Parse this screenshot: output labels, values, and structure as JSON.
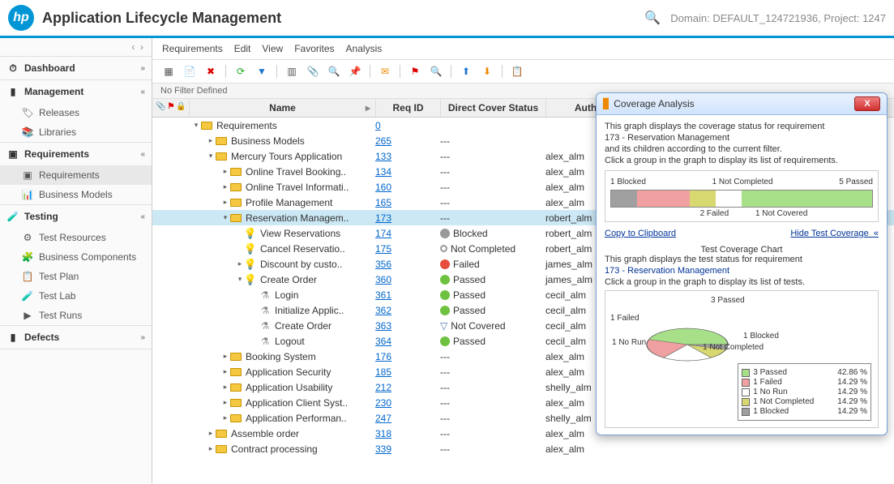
{
  "header": {
    "app_title": "Application Lifecycle Management",
    "domain_label": "Domain: DEFAULT_124721936, Project: 1247"
  },
  "sidebar": {
    "sections": [
      {
        "label": "Dashboard",
        "expand": "»",
        "items": []
      },
      {
        "label": "Management",
        "expand": "«",
        "items": [
          {
            "label": "Releases"
          },
          {
            "label": "Libraries"
          }
        ]
      },
      {
        "label": "Requirements",
        "expand": "«",
        "items": [
          {
            "label": "Requirements",
            "selected": true
          },
          {
            "label": "Business Models"
          }
        ]
      },
      {
        "label": "Testing",
        "expand": "«",
        "items": [
          {
            "label": "Test Resources"
          },
          {
            "label": "Business Components"
          },
          {
            "label": "Test Plan"
          },
          {
            "label": "Test Lab"
          },
          {
            "label": "Test Runs"
          }
        ]
      },
      {
        "label": "Defects",
        "expand": "»",
        "items": []
      }
    ]
  },
  "menubar": [
    "Requirements",
    "Edit",
    "View",
    "Favorites",
    "Analysis"
  ],
  "filter_text": "No Filter Defined",
  "columns": {
    "name": "Name",
    "reqid": "Req ID",
    "status": "Direct Cover Status",
    "author": "Author"
  },
  "rows": [
    {
      "indent": 0,
      "tog": "▾",
      "icon": "folder",
      "name": "Requirements",
      "reqid": "0",
      "status": "",
      "sicon": "",
      "author": ""
    },
    {
      "indent": 1,
      "tog": "▸",
      "icon": "folder",
      "name": "Business Models",
      "reqid": "265",
      "status": "---",
      "sicon": "",
      "author": ""
    },
    {
      "indent": 1,
      "tog": "▾",
      "icon": "folder",
      "name": "Mercury Tours Application",
      "reqid": "133",
      "status": "---",
      "sicon": "",
      "author": "alex_alm"
    },
    {
      "indent": 2,
      "tog": "▸",
      "icon": "folder",
      "name": "Online Travel Booking..",
      "reqid": "134",
      "status": "---",
      "sicon": "",
      "author": "alex_alm"
    },
    {
      "indent": 2,
      "tog": "▸",
      "icon": "folder",
      "name": "Online Travel Informati..",
      "reqid": "160",
      "status": "---",
      "sicon": "",
      "author": "alex_alm"
    },
    {
      "indent": 2,
      "tog": "▸",
      "icon": "folder",
      "name": "Profile Management",
      "reqid": "165",
      "status": "---",
      "sicon": "",
      "author": "alex_alm"
    },
    {
      "indent": 2,
      "tog": "▾",
      "icon": "folder",
      "name": "Reservation Managem..",
      "reqid": "173",
      "status": "---",
      "sicon": "",
      "author": "robert_alm",
      "sel": true
    },
    {
      "indent": 3,
      "tog": "",
      "icon": "bulb",
      "name": "View Reservations",
      "reqid": "174",
      "status": "Blocked",
      "sicon": "blocked",
      "author": "robert_alm"
    },
    {
      "indent": 3,
      "tog": "",
      "icon": "bulb",
      "name": "Cancel Reservatio..",
      "reqid": "175",
      "status": "Not Completed",
      "sicon": "notcomp",
      "author": "robert_alm"
    },
    {
      "indent": 3,
      "tog": "▸",
      "icon": "bulb",
      "name": "Discount by custo..",
      "reqid": "356",
      "status": "Failed",
      "sicon": "failed",
      "author": "james_alm"
    },
    {
      "indent": 3,
      "tog": "▾",
      "icon": "bulb",
      "name": "Create Order",
      "reqid": "360",
      "status": "Passed",
      "sicon": "passed",
      "author": "james_alm"
    },
    {
      "indent": 4,
      "tog": "",
      "icon": "flask",
      "name": "Login",
      "reqid": "361",
      "status": "Passed",
      "sicon": "passed",
      "author": "cecil_alm"
    },
    {
      "indent": 4,
      "tog": "",
      "icon": "flask",
      "name": "Initialize Applic..",
      "reqid": "362",
      "status": "Passed",
      "sicon": "passed",
      "author": "cecil_alm"
    },
    {
      "indent": 4,
      "tog": "",
      "icon": "flask",
      "name": "Create Order",
      "reqid": "363",
      "status": "Not Covered",
      "sicon": "notcov",
      "author": "cecil_alm"
    },
    {
      "indent": 4,
      "tog": "",
      "icon": "flask",
      "name": "Logout",
      "reqid": "364",
      "status": "Passed",
      "sicon": "passed",
      "author": "cecil_alm"
    },
    {
      "indent": 2,
      "tog": "▸",
      "icon": "folder",
      "name": "Booking System",
      "reqid": "176",
      "status": "---",
      "sicon": "",
      "author": "alex_alm"
    },
    {
      "indent": 2,
      "tog": "▸",
      "icon": "folder",
      "name": "Application Security",
      "reqid": "185",
      "status": "---",
      "sicon": "",
      "author": "alex_alm"
    },
    {
      "indent": 2,
      "tog": "▸",
      "icon": "folder",
      "name": "Application Usability",
      "reqid": "212",
      "status": "---",
      "sicon": "",
      "author": "shelly_alm"
    },
    {
      "indent": 2,
      "tog": "▸",
      "icon": "folder",
      "name": "Application Client Syst..",
      "reqid": "230",
      "status": "---",
      "sicon": "",
      "author": "alex_alm"
    },
    {
      "indent": 2,
      "tog": "▸",
      "icon": "folder",
      "name": "Application Performan..",
      "reqid": "247",
      "status": "---",
      "sicon": "",
      "author": "shelly_alm"
    },
    {
      "indent": 1,
      "tog": "▸",
      "icon": "folder",
      "name": "Assemble order",
      "reqid": "318",
      "status": "---",
      "sicon": "",
      "author": "alex_alm"
    },
    {
      "indent": 1,
      "tog": "▸",
      "icon": "folder",
      "name": "Contract processing",
      "reqid": "339",
      "status": "---",
      "sicon": "",
      "author": "alex_alm"
    }
  ],
  "panel": {
    "title": "Coverage Analysis",
    "intro1": "This graph displays the coverage status for requirement",
    "intro2": "173 - Reservation Management",
    "intro3": "and its children according to the current filter.",
    "intro4": "Click a group in the graph to display its list of requirements.",
    "bar_top": {
      "l1": "1 Blocked",
      "l2": "1 Not Completed",
      "l3": "5 Passed"
    },
    "bar_bot": {
      "l1": "2 Failed",
      "l2": "1 Not Covered"
    },
    "copy": "Copy to Clipboard",
    "hide": "Hide Test Coverage",
    "chart2_title": "Test Coverage Chart",
    "chart2_p1": "This graph displays the test status for requirement",
    "chart2_p2": "173 - Reservation Management",
    "chart2_p3": "Click a group in the graph to display its list of tests.",
    "pie_labels": {
      "p": "3 Passed",
      "f": "1 Failed",
      "n": "1 No Run",
      "b": "1 Blocked",
      "nc": "1 Not Completed"
    },
    "legend": [
      {
        "c": "#a8e08a",
        "t": "3 Passed",
        "p": "42.86 %"
      },
      {
        "c": "#f0a0a0",
        "t": "1 Failed",
        "p": "14.29 %"
      },
      {
        "c": "#ffffff",
        "t": "1 No Run",
        "p": "14.29 %"
      },
      {
        "c": "#d8d870",
        "t": "1 Not Completed",
        "p": "14.29 %"
      },
      {
        "c": "#a0a0a0",
        "t": "1 Blocked",
        "p": "14.29 %"
      }
    ]
  },
  "chart_data": [
    {
      "type": "bar",
      "title": "Coverage status for requirement 173 - Reservation Management",
      "categories": [
        "Blocked",
        "Failed",
        "Not Completed",
        "Not Covered",
        "Passed"
      ],
      "values": [
        1,
        2,
        1,
        1,
        5
      ],
      "colors": [
        "#a0a0a0",
        "#f0a0a0",
        "#d8d870",
        "#ffffff",
        "#a8e08a"
      ]
    },
    {
      "type": "pie",
      "title": "Test Coverage Chart",
      "categories": [
        "Passed",
        "Failed",
        "No Run",
        "Not Completed",
        "Blocked"
      ],
      "values": [
        3,
        1,
        1,
        1,
        1
      ],
      "percentages": [
        42.86,
        14.29,
        14.29,
        14.29,
        14.29
      ],
      "colors": [
        "#a8e08a",
        "#f0a0a0",
        "#ffffff",
        "#d8d870",
        "#a0a0a0"
      ]
    }
  ]
}
